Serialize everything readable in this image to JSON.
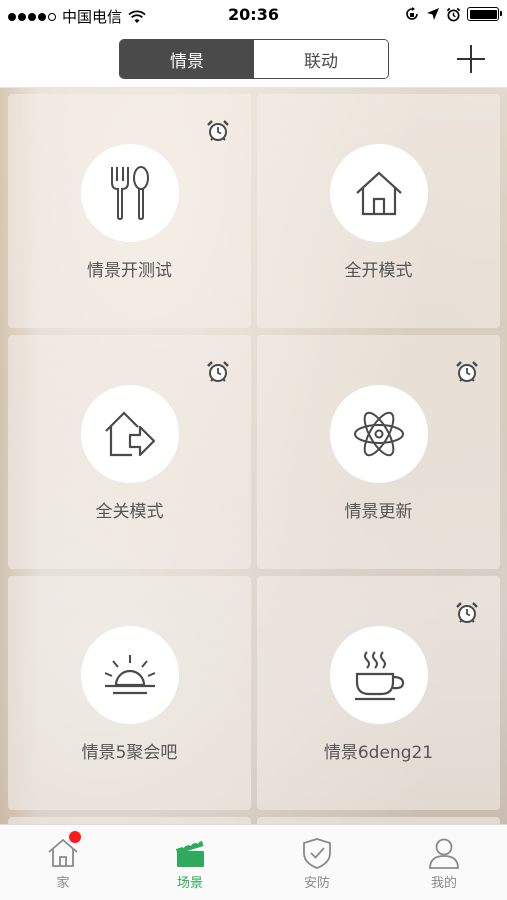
{
  "status_bar": {
    "carrier": "中国电信",
    "time": "20:36"
  },
  "header": {
    "tabs": [
      {
        "label": "情景",
        "active": true
      },
      {
        "label": "联动",
        "active": false
      }
    ],
    "add_icon": "plus-icon"
  },
  "scenes": [
    {
      "label": "情景开测试",
      "icon": "fork-spoon-icon",
      "has_alarm": true
    },
    {
      "label": "全开模式",
      "icon": "house-icon",
      "has_alarm": false
    },
    {
      "label": "全关模式",
      "icon": "house-arrow-icon",
      "has_alarm": true
    },
    {
      "label": "情景更新",
      "icon": "atom-icon",
      "has_alarm": true
    },
    {
      "label": "情景5聚会吧",
      "icon": "sunrise-icon",
      "has_alarm": false
    },
    {
      "label": "情景6deng21",
      "icon": "coffee-cup-icon",
      "has_alarm": true
    }
  ],
  "tabbar": {
    "items": [
      {
        "label": "家",
        "icon": "home-icon",
        "badge": true
      },
      {
        "label": "场景",
        "icon": "clapperboard-icon",
        "active": true
      },
      {
        "label": "安防",
        "icon": "shield-icon"
      },
      {
        "label": "我的",
        "icon": "person-icon"
      }
    ],
    "accent_color": "#2daa5b",
    "badge_color": "#ff1a1a"
  }
}
